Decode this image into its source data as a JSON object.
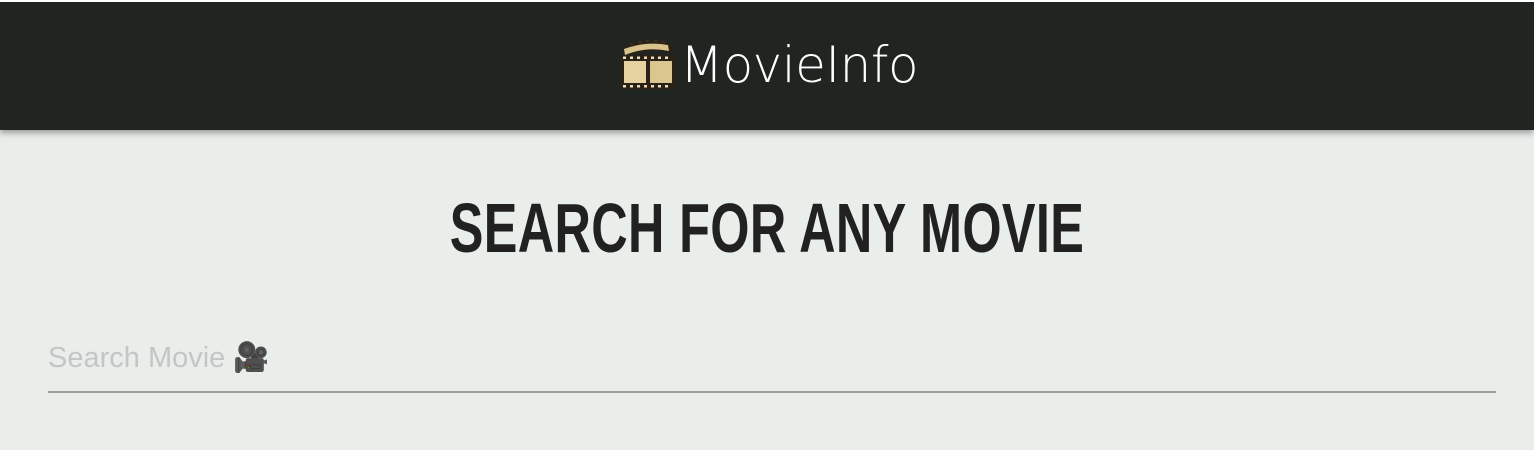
{
  "navbar": {
    "brand_name": "MovieInfo",
    "logo_icon": "film-reel-icon",
    "background_color": "#212522"
  },
  "main": {
    "heading": "SEARCH FOR ANY MOVIE",
    "background_color": "#eaeeeb"
  },
  "search": {
    "placeholder": "Search Movie 🎥",
    "value": ""
  }
}
